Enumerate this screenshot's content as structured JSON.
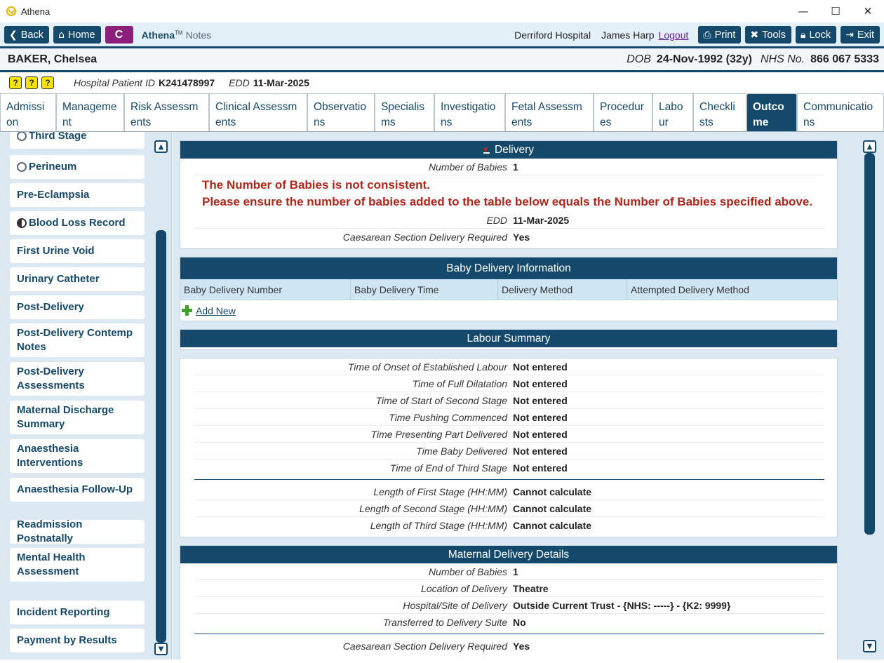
{
  "window": {
    "title": "Athena",
    "controls": {
      "minimize": "—",
      "maximize": "☐",
      "close": "✕"
    }
  },
  "toolbar": {
    "back_label": "Back",
    "home_label": "Home",
    "c_label": "C",
    "brand_name": "Athena",
    "brand_tm": "TM",
    "brand_module": "Notes",
    "hospital": "Derriford Hospital",
    "user": "James Harp",
    "logout_label": "Logout",
    "print_label": "Print",
    "tools_label": "Tools",
    "lock_label": "Lock",
    "exit_label": "Exit"
  },
  "patient": {
    "name": "BAKER, Chelsea",
    "dob_label": "DOB",
    "dob_value": "24-Nov-1992 (32y)",
    "nhs_label": "NHS No.",
    "nhs_value": "866 067 5333"
  },
  "subbar": {
    "alert_icons": [
      "?",
      "?",
      "?"
    ],
    "hospital_id_label": "Hospital Patient ID",
    "hospital_id_value": "K241478997",
    "edd_label": "EDD",
    "edd_value": "11-Mar-2025"
  },
  "tabs": [
    {
      "label": "Admission",
      "active": false
    },
    {
      "label": "Management",
      "active": false
    },
    {
      "label": "Risk Assessments",
      "active": false
    },
    {
      "label": "Clinical Assessments",
      "active": false
    },
    {
      "label": "Observations",
      "active": false
    },
    {
      "label": "Specialisms",
      "active": false
    },
    {
      "label": "Investigations",
      "active": false
    },
    {
      "label": "Fetal Assessments",
      "active": false
    },
    {
      "label": "Procedures",
      "active": false
    },
    {
      "label": "Labour",
      "active": false
    },
    {
      "label": "Checklists",
      "active": false
    },
    {
      "label": "Outcome",
      "active": true
    },
    {
      "label": "Communications",
      "active": false
    }
  ],
  "sidebar": {
    "items": [
      {
        "label": "Third Stage",
        "status": "empty"
      },
      {
        "label": "Perineum",
        "status": "empty"
      },
      {
        "label": "Pre-Eclampsia",
        "status": "none"
      },
      {
        "label": "Blood Loss Record",
        "status": "partial"
      },
      {
        "label": "First Urine Void",
        "status": "none"
      },
      {
        "label": "Urinary Catheter",
        "status": "none"
      },
      {
        "label": "Post-Delivery",
        "status": "none"
      },
      {
        "label": "Post-Delivery Contemp Notes",
        "status": "none"
      },
      {
        "label": "Post-Delivery Assessments",
        "status": "none"
      },
      {
        "label": "Maternal Discharge Summary",
        "status": "none"
      },
      {
        "label": "Anaesthesia Interventions",
        "status": "none"
      },
      {
        "label": "Anaesthesia Follow-Up",
        "status": "none"
      },
      {
        "label": "Readmission Postnatally",
        "status": "none"
      },
      {
        "label": "Mental Health Assessment",
        "status": "none"
      },
      {
        "label": "Incident Reporting",
        "status": "none"
      },
      {
        "label": "Payment by Results",
        "status": "none"
      }
    ]
  },
  "delivery": {
    "title": "Delivery",
    "number_of_babies_label": "Number of Babies",
    "number_of_babies_value": "1",
    "warning_line1": "The Number of Babies is not consistent.",
    "warning_line2": "Please ensure the number of babies added to the table below equals the Number of Babies specified above.",
    "edd_label": "EDD",
    "edd_value": "11-Mar-2025",
    "caesarean_label": "Caesarean Section Delivery Required",
    "caesarean_value": "Yes"
  },
  "baby_delivery": {
    "title": "Baby Delivery Information",
    "columns": [
      "Baby Delivery Number",
      "Baby Delivery Time",
      "Delivery Method",
      "Attempted Delivery Method"
    ],
    "add_new_label": "Add New"
  },
  "labour_summary": {
    "title": "Labour Summary",
    "rows": [
      {
        "label": "Time of Onset of Established Labour",
        "value": "Not entered"
      },
      {
        "label": "Time of Full Dilatation",
        "value": "Not entered"
      },
      {
        "label": "Time of Start of Second Stage",
        "value": "Not entered"
      },
      {
        "label": "Time Pushing Commenced",
        "value": "Not entered"
      },
      {
        "label": "Time Presenting Part Delivered",
        "value": "Not entered"
      },
      {
        "label": "Time Baby Delivered",
        "value": "Not entered"
      },
      {
        "label": "Time of End of Third Stage",
        "value": "Not entered"
      }
    ],
    "length_rows": [
      {
        "label": "Length of First Stage (HH:MM)",
        "value": "Cannot calculate"
      },
      {
        "label": "Length of Second Stage (HH:MM)",
        "value": "Cannot calculate"
      },
      {
        "label": "Length of Third Stage (HH:MM)",
        "value": "Cannot calculate"
      }
    ]
  },
  "maternal_delivery": {
    "title": "Maternal Delivery Details",
    "rows": [
      {
        "label": "Number of Babies",
        "value": "1"
      },
      {
        "label": "Location of Delivery",
        "value": "Theatre"
      },
      {
        "label": "Hospital/Site of Delivery",
        "value": "Outside Current Trust - {NHS: -----} - {K2: 9999}"
      },
      {
        "label": "Transferred to Delivery Suite",
        "value": "No"
      }
    ],
    "caesarean_label": "Caesarean Section Delivery Required",
    "caesarean_value": "Yes"
  }
}
